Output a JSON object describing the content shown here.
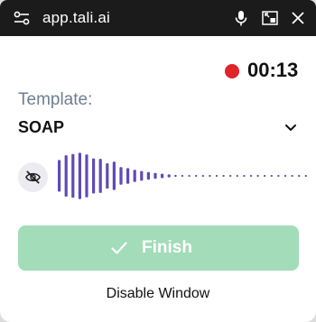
{
  "titlebar": {
    "title": "app.tali.ai",
    "left_icon": "settings-sliders-icon",
    "icons": [
      "microphone-icon",
      "picture-in-picture-icon",
      "close-icon"
    ]
  },
  "recording": {
    "time": "00:13",
    "indicator_color": "#e0242a"
  },
  "template": {
    "label": "Template:",
    "value": "SOAP"
  },
  "waveform": {
    "color": "#5f4bb6",
    "visibility_icon": "eye-off-icon",
    "levels": [
      0.65,
      0.85,
      0.9,
      0.95,
      0.88,
      0.72,
      0.7,
      0.52,
      0.58,
      0.36,
      0.32,
      0.25,
      0.2,
      0.16,
      0.12,
      0.09,
      0.06,
      0.04,
      0.03,
      0.03,
      0.02,
      0.02,
      0.02,
      0.02,
      0.02,
      0.02,
      0.02,
      0.02,
      0.02,
      0.02,
      0.02,
      0.02,
      0.02,
      0.02,
      0.02,
      0.02,
      0.02
    ]
  },
  "actions": {
    "finish_label": "Finish",
    "finish_color": "#a3dcb8",
    "disable_label": "Disable Window"
  }
}
